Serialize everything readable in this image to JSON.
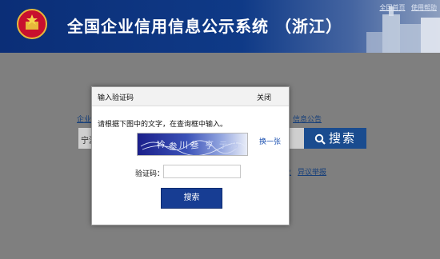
{
  "header": {
    "site_title": "全国企业信用信息公示系统 （浙江）",
    "links": [
      "全国首页",
      "使用帮助"
    ]
  },
  "background": {
    "nav_left": "企业",
    "nav_right": "信息公告",
    "search_prefix": "宁波",
    "search_button": "搜索",
    "link_a": "业",
    "link_b": "异议举报"
  },
  "modal": {
    "title": "输入验证码",
    "close": "关闭",
    "instruction": "请根据下图中的文字，在查询框中输入。",
    "refresh": "换一张",
    "code_label": "验证码：",
    "code_value": "",
    "submit": "搜索"
  },
  "colors": {
    "header_blue": "#0f3a87",
    "button_blue": "#173d93",
    "overlay_gray": "#7f7f7f"
  }
}
